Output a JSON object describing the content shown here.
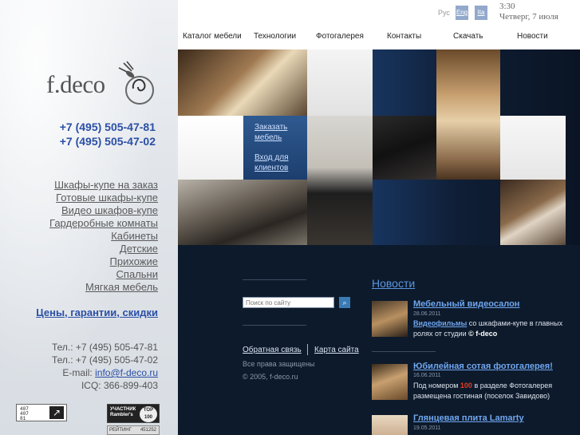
{
  "brand": {
    "logo_text": "f.deco"
  },
  "phones": [
    "+7 (495) 505-47-81",
    "+7 (495) 505-47-02"
  ],
  "left_nav": [
    "Шкафы-купе на заказ",
    "Готовые шкафы-купе",
    "Видео шкафов-купе",
    "Гардеробные комнаты",
    "Кабинеты",
    "Детские",
    "Прихожие",
    "Спальни",
    "Мягкая мебель"
  ],
  "prices_link": "Цены, гарантии, скидки",
  "contacts": {
    "tel1": "Тел.: +7 (495) 505-47-81",
    "tel2": "Тел.: +7 (495) 505-47-02",
    "email_label": "E-mail:",
    "email": "info@f-deco.ru",
    "icq": "ICQ: 366-899-403"
  },
  "badges": {
    "badge1_text": "407\n407\n81",
    "badge2_line1": "УЧАСТНИК",
    "badge2_line2": "Rambler's",
    "badge2_top": "TOP\n100",
    "counter_label": "РЕЙТИНГ",
    "counter_value": "451252"
  },
  "lang": {
    "label": "Рус",
    "eng": "Eng",
    "ita": "Ita"
  },
  "clock": {
    "time": "3:30",
    "date": "Четверг, 7 июля"
  },
  "menu": [
    "Каталог мебели",
    "Технологии",
    "Фотогалерея",
    "Контакты",
    "Скачать",
    "Новости"
  ],
  "promo": {
    "order": "Заказать мебель",
    "login": "Вход для клиентов"
  },
  "search": {
    "placeholder": "Поиск по сайту",
    "button": "⌕"
  },
  "footer": {
    "feedback": "Обратная связь",
    "sitemap": "Карта сайта",
    "rights": "Все права защищены",
    "copyright": "© 2005, f-deco.ru"
  },
  "news": {
    "heading": "Новости",
    "items": [
      {
        "title": "Мебельный видеосалон",
        "date": "28.06.2011",
        "link": "Видеофильмы",
        "text_a": " со шкафами-купе в главных ролях от студии ",
        "brand": "© f-deco"
      },
      {
        "title": "Юбилейная сотая фотогалерея!",
        "date": "16.06.2011",
        "text_a": "Под номером ",
        "number": "100",
        "text_b": " в разделе Фотогалерея размещена гостиная (поселок Завидово)"
      },
      {
        "title": "Глянцевая плита Lamarty",
        "date": "19.05.2011"
      }
    ]
  },
  "colors": {
    "accent": "#2b4fa6",
    "news_link": "#6fa7f0",
    "dark_bg": "#0d1a2b",
    "highlight": "#e63a21"
  }
}
